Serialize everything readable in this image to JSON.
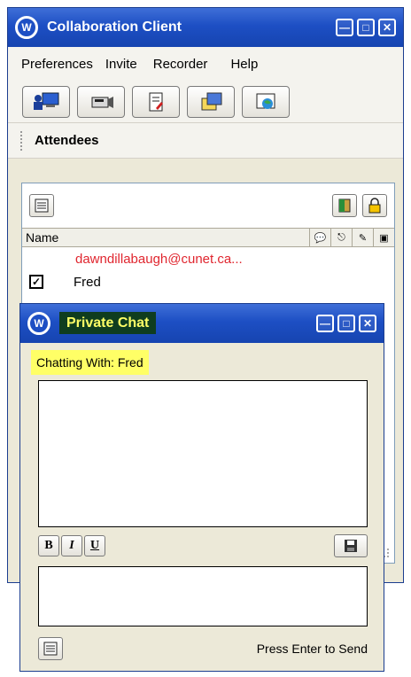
{
  "main_window": {
    "title": "Collaboration Client",
    "logo_text": "W",
    "menu": [
      "Preferences",
      "Invite",
      "Recorder",
      "Help"
    ],
    "toolbar_icons": [
      "presenter-icon",
      "camera-icon",
      "document-edit-icon",
      "folders-icon",
      "desktop-share-icon"
    ],
    "section_title": "Attendees",
    "attendees": {
      "column_name": "Name",
      "column_icons": [
        "chat-bubble-icon",
        "mouse-icon",
        "pen-icon",
        "video-icon"
      ],
      "rows": [
        {
          "name": "dawndillabaugh@cunet.ca..."
        },
        {
          "name": "Fred"
        }
      ]
    }
  },
  "chat_window": {
    "title": "Private Chat",
    "logo_text": "W",
    "chatting_with": "Chatting With: Fred",
    "format_buttons": [
      "B",
      "I",
      "U"
    ],
    "send_hint": "Press Enter to Send"
  },
  "colors": {
    "title_bar": "#1d4fc4",
    "email": "#e0262f",
    "highlight": "#ffff66",
    "chat_title_bg": "#0f3d1f"
  }
}
